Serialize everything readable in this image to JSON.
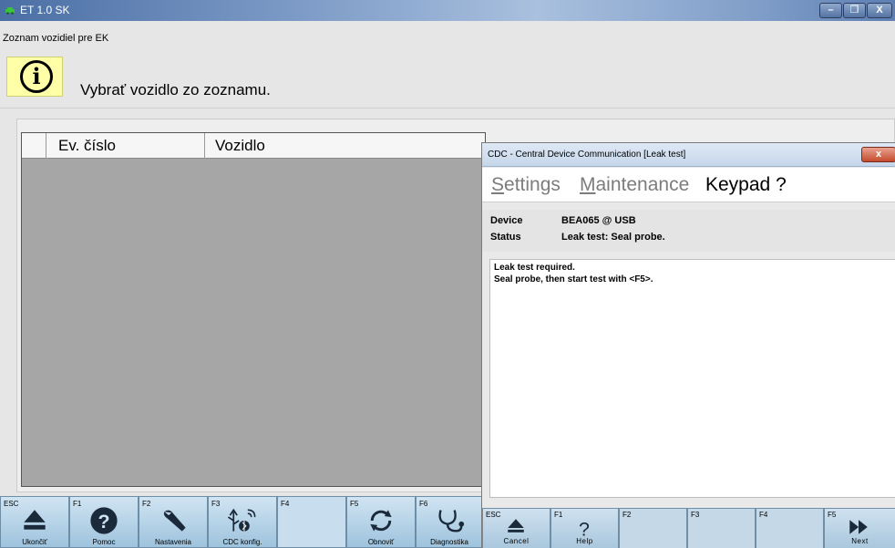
{
  "window": {
    "title": "ET 1.0 SK",
    "controls": {
      "minimize": "–",
      "maximize": "❐",
      "close": "X"
    }
  },
  "breadcrumb": "Zoznam vozidiel pre EK",
  "info": {
    "icon": "info-icon",
    "glyph": "i",
    "message": "Vybrať vozidlo zo zoznamu."
  },
  "table": {
    "columns": [
      "Ev. číslo",
      "Vozidlo"
    ]
  },
  "fkeys": [
    {
      "key": "ESC",
      "label": "Ukončiť",
      "icon": "eject-icon"
    },
    {
      "key": "F1",
      "label": "Pomoc",
      "icon": "help-icon"
    },
    {
      "key": "F2",
      "label": "Nastavenia",
      "icon": "wrench-icon"
    },
    {
      "key": "F3",
      "label": "CDC konfig.",
      "icon": "usb-bluetooth-wifi-icon"
    },
    {
      "key": "F4",
      "label": "",
      "icon": ""
    },
    {
      "key": "F5",
      "label": "Obnoviť",
      "icon": "refresh-icon"
    },
    {
      "key": "F6",
      "label": "Diagnostika",
      "icon": "stethoscope-icon"
    }
  ],
  "dialog": {
    "title": "CDC - Central Device Communication [Leak test]",
    "close_label": "x",
    "menu": {
      "settings_first": "S",
      "settings_rest": "ettings",
      "maintenance_first": "M",
      "maintenance_rest": "aintenance",
      "keypad": "Keypad",
      "help": "?"
    },
    "info": {
      "device_label": "Device",
      "device_value": "BEA065 @ USB",
      "status_label": "Status",
      "status_value": "Leak test: Seal probe."
    },
    "body": [
      "Leak test required.",
      "Seal probe, then start test with <F5>."
    ],
    "keys": [
      {
        "key": "ESC",
        "label": "Cancel",
        "icon": "eject-icon"
      },
      {
        "key": "F1",
        "label": "Help",
        "icon": "question-icon"
      },
      {
        "key": "F2",
        "label": "",
        "icon": ""
      },
      {
        "key": "F3",
        "label": "",
        "icon": ""
      },
      {
        "key": "F4",
        "label": "",
        "icon": ""
      },
      {
        "key": "F5",
        "label": "Next",
        "icon": "next-icon"
      }
    ]
  }
}
